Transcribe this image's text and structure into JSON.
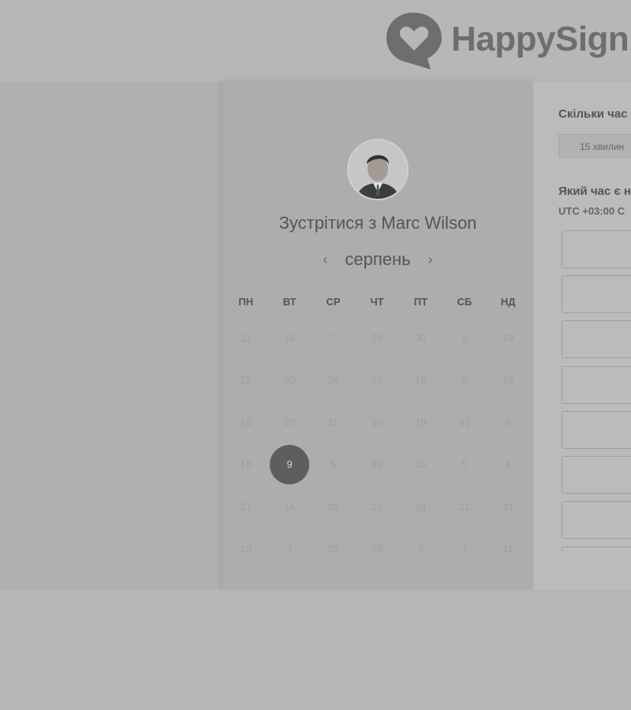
{
  "brand": {
    "name": "HappySign"
  },
  "meeting": {
    "title": "Зустрітися з Marc Wilson",
    "month": "серпень",
    "prev_icon": "‹",
    "next_icon": "›"
  },
  "calendar": {
    "weekdays": [
      "ПН",
      "ВТ",
      "СР",
      "ЧТ",
      "ПТ",
      "СБ",
      "НД"
    ],
    "weeks": [
      [
        "11",
        "16",
        "7",
        "25",
        "30",
        "9",
        "19"
      ],
      [
        "22",
        "30",
        "26",
        "15",
        "18",
        "5",
        "16"
      ],
      [
        "16",
        "20",
        "11",
        "30",
        "19",
        "31",
        "9"
      ],
      [
        "16",
        "9",
        "5",
        "22",
        "25",
        "5",
        "4"
      ],
      [
        "27",
        "14",
        "28",
        "25",
        "24",
        "21",
        "31"
      ],
      [
        "10",
        "3",
        "25",
        "28",
        "7",
        "1",
        "11"
      ]
    ],
    "selected": "9"
  },
  "booking": {
    "duration_question": "Скільки час",
    "duration_option": "15 хвилин",
    "time_question": "Який час є н",
    "timezone": "UTC +03:00 С"
  },
  "colors": {
    "selected_day": "#5e5e5e",
    "background": "#b6b6b6"
  }
}
